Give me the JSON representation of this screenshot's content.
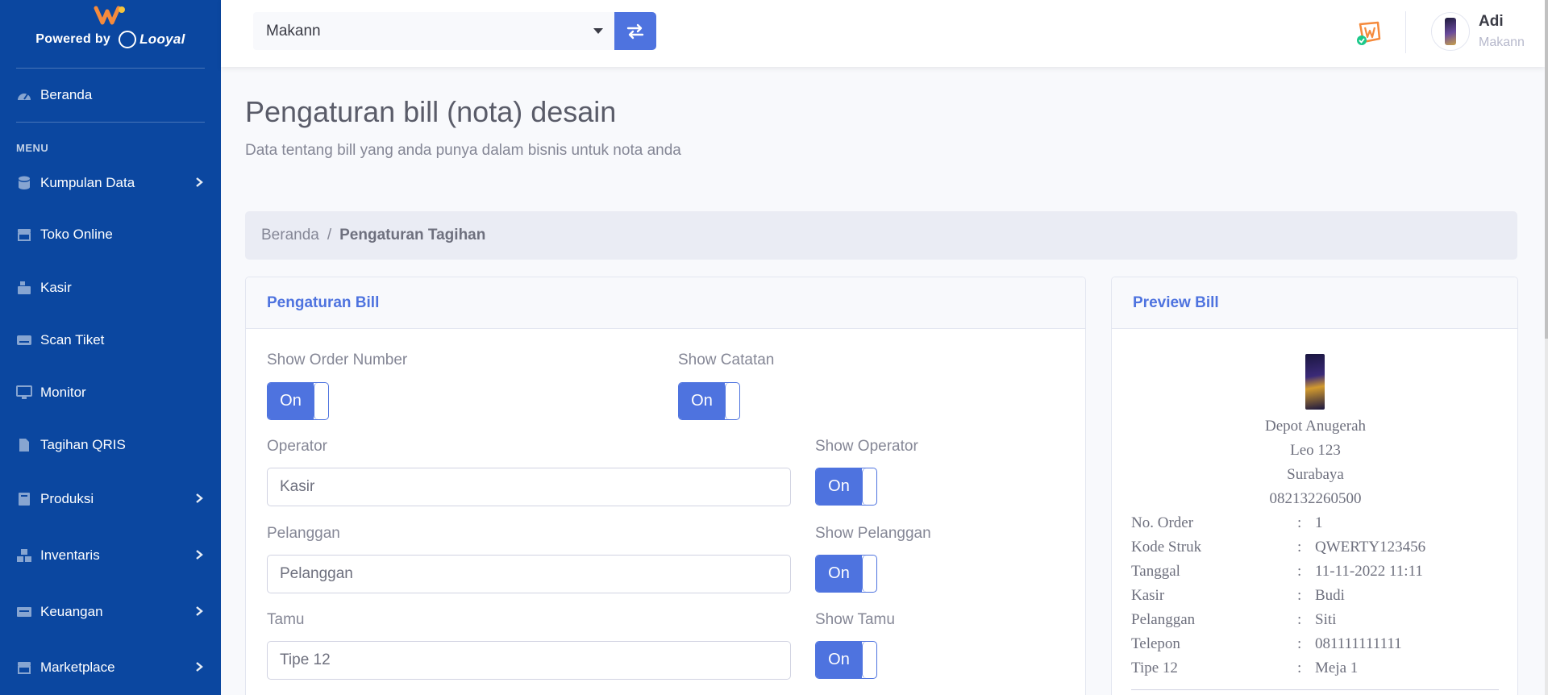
{
  "sidebar": {
    "powered_by": "Powered by",
    "brand_name": "Looyal",
    "home": "Beranda",
    "menu_heading": "MENU",
    "items": [
      {
        "label": "Kumpulan Data",
        "icon": "database-icon",
        "has_children": true
      },
      {
        "label": "Toko Online",
        "icon": "store-icon",
        "has_children": false
      },
      {
        "label": "Kasir",
        "icon": "cash-register-icon",
        "has_children": false
      },
      {
        "label": "Scan Tiket",
        "icon": "keyboard-icon",
        "has_children": false
      },
      {
        "label": "Monitor",
        "icon": "desktop-icon",
        "has_children": false
      },
      {
        "label": "Tagihan QRIS",
        "icon": "file-invoice-icon",
        "has_children": false
      },
      {
        "label": "Produksi",
        "icon": "book-icon",
        "has_children": true
      },
      {
        "label": "Inventaris",
        "icon": "cubes-icon",
        "has_children": true
      },
      {
        "label": "Keuangan",
        "icon": "money-icon",
        "has_children": true
      },
      {
        "label": "Marketplace",
        "icon": "store-icon",
        "has_children": true
      }
    ]
  },
  "topbar": {
    "business_select": "Makann",
    "user_name": "Adi",
    "user_business": "Makann"
  },
  "page": {
    "title": "Pengaturan bill (nota) desain",
    "subtitle": "Data tentang bill yang anda punya dalam bisnis untuk nota anda"
  },
  "breadcrumb": {
    "home": "Beranda",
    "separator": "/",
    "current": "Pengaturan Tagihan"
  },
  "settings": {
    "header": "Pengaturan Bill",
    "toggle_on_label": "On",
    "show_order_number_label": "Show Order Number",
    "show_catatan_label": "Show Catatan",
    "operator_label": "Operator",
    "operator_value": "Kasir",
    "show_operator_label": "Show Operator",
    "pelanggan_label": "Pelanggan",
    "pelanggan_value": "Pelanggan",
    "show_pelanggan_label": "Show Pelanggan",
    "tamu_label": "Tamu",
    "tamu_value": "Tipe 12",
    "show_tamu_label": "Show Tamu"
  },
  "preview": {
    "header": "Preview Bill",
    "store_name": "Depot Anugerah",
    "address": "Leo 123",
    "city": "Surabaya",
    "phone": "082132260500",
    "colon": ":",
    "rows": [
      {
        "key": "No. Order",
        "value": "1"
      },
      {
        "key": "Kode Struk",
        "value": "QWERTY123456"
      },
      {
        "key": "Tanggal",
        "value": "11-11-2022 11:11"
      },
      {
        "key": "Kasir",
        "value": "Budi"
      },
      {
        "key": "Pelanggan",
        "value": "Siti"
      },
      {
        "key": "Telepon",
        "value": "081111111111"
      },
      {
        "key": "Tipe 12",
        "value": "Meja 1"
      }
    ]
  },
  "colors": {
    "sidebar_bg": "#0b47a0",
    "primary": "#4e73df",
    "page_bg": "#f8f9fc"
  }
}
